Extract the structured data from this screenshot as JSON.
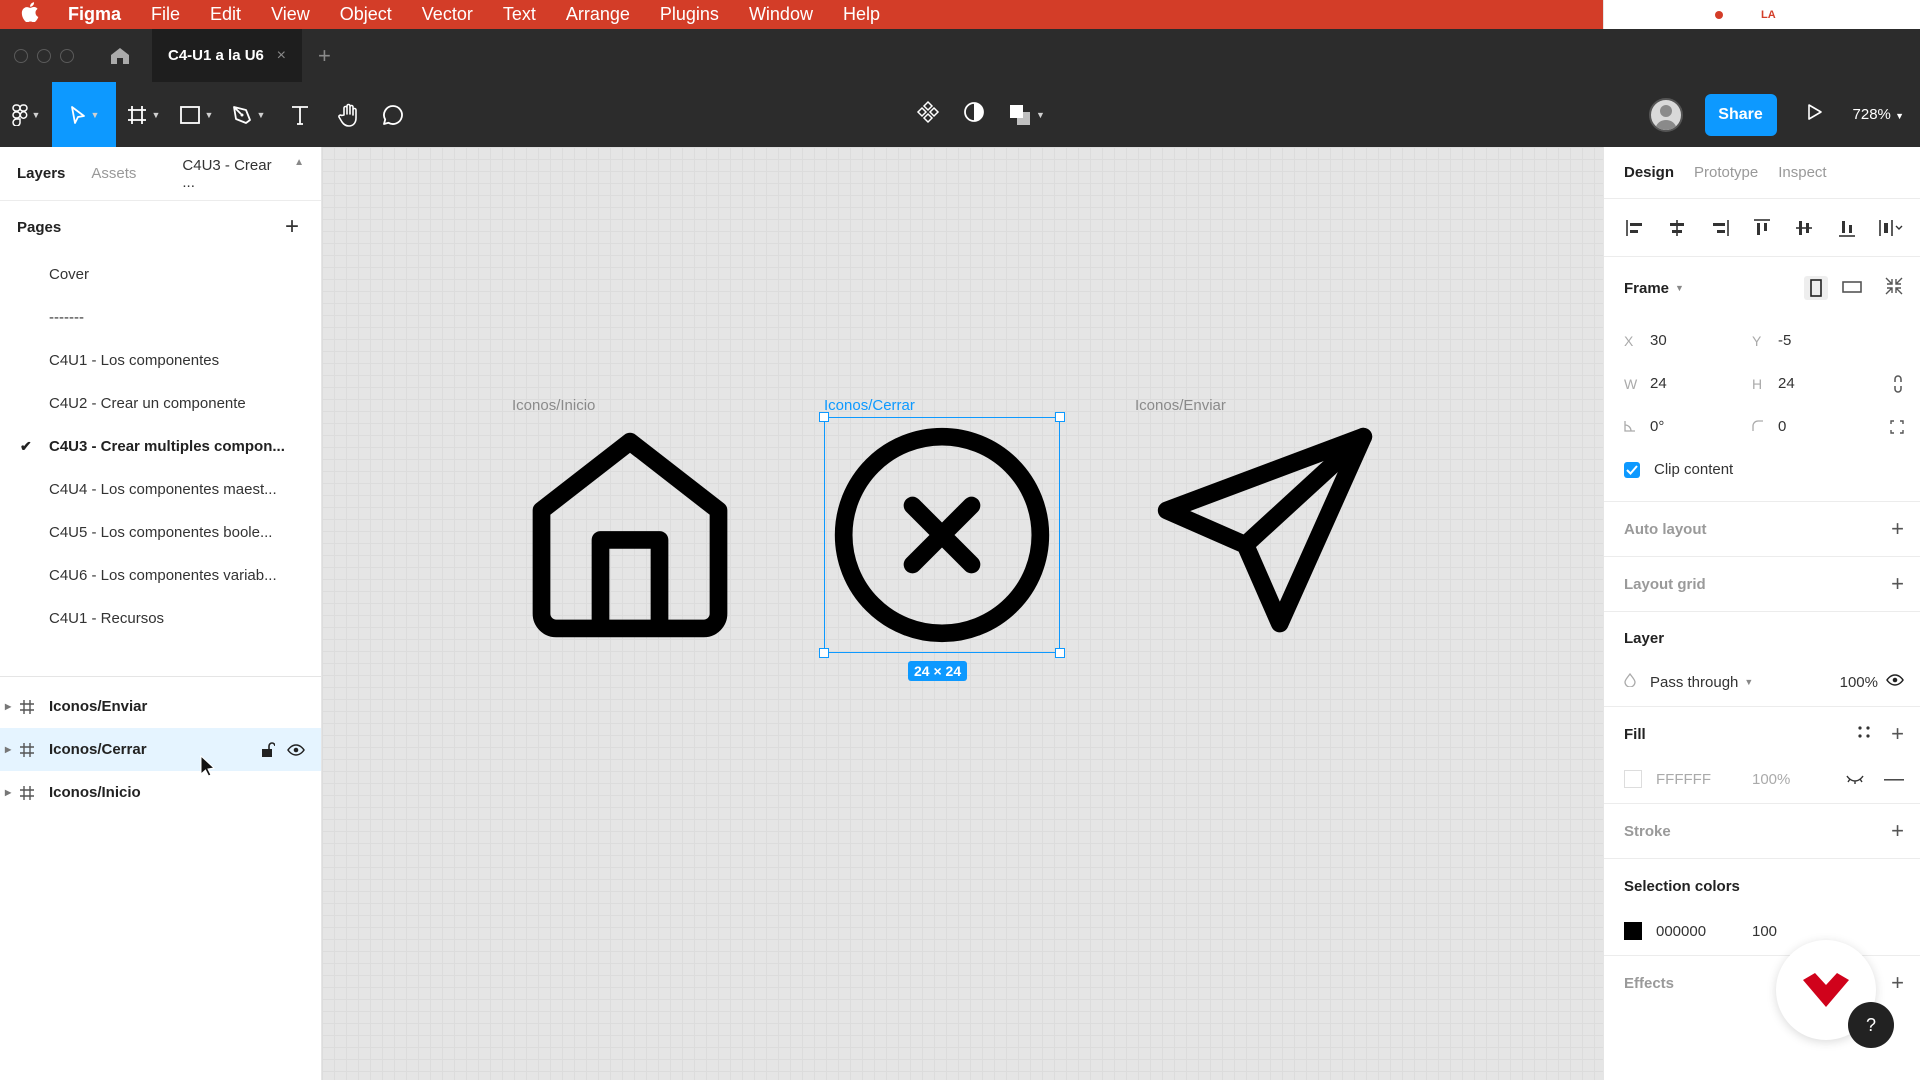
{
  "menubar": {
    "app": "Figma",
    "items": [
      "File",
      "Edit",
      "View",
      "Object",
      "Vector",
      "Text",
      "Arrange",
      "Plugins",
      "Window",
      "Help"
    ],
    "status_icons": [
      "creative-cloud-icon",
      "cloud-icon",
      "sync-icon",
      "language-icon",
      "bluetooth-icon",
      "wifi-icon",
      "search-icon",
      "control-center-icon",
      "clock-icon"
    ],
    "lang": "LA"
  },
  "tabbar": {
    "tab_title": "C4-U1 a la U6",
    "close": "×",
    "add": "+"
  },
  "toolbar": {
    "share_label": "Share",
    "zoom": "728%"
  },
  "left_panel": {
    "tabs": [
      "Layers",
      "Assets"
    ],
    "current_page": "C4U3 - Crear ...",
    "pages_title": "Pages",
    "pages": [
      {
        "label": "Cover",
        "selected": false
      },
      {
        "label": "-------",
        "selected": false
      },
      {
        "label": "C4U1 - Los componentes",
        "selected": false
      },
      {
        "label": "C4U2 - Crear un componente",
        "selected": false
      },
      {
        "label": "C4U3 - Crear multiples compon...",
        "selected": true
      },
      {
        "label": "C4U4 - Los componentes maest...",
        "selected": false
      },
      {
        "label": "C4U5 - Los componentes boole...",
        "selected": false
      },
      {
        "label": "C4U6 - Los componentes variab...",
        "selected": false
      },
      {
        "label": "C4U1 - Recursos",
        "selected": false
      }
    ],
    "layers": [
      {
        "label": "Iconos/Enviar",
        "highlighted": false
      },
      {
        "label": "Iconos/Cerrar",
        "highlighted": true
      },
      {
        "label": "Iconos/Inicio",
        "highlighted": false
      }
    ]
  },
  "canvas": {
    "frames": [
      {
        "label": "Iconos/Inicio",
        "icon": "home-icon"
      },
      {
        "label": "Iconos/Cerrar",
        "icon": "close-circle-icon"
      },
      {
        "label": "Iconos/Enviar",
        "icon": "send-icon"
      }
    ],
    "size_badge": "24 × 24"
  },
  "right_panel": {
    "tabs": [
      "Design",
      "Prototype",
      "Inspect"
    ],
    "frame": {
      "title": "Frame",
      "x_label": "X",
      "x": "30",
      "y_label": "Y",
      "y": "-5",
      "w_label": "W",
      "w": "24",
      "h_label": "H",
      "h": "24",
      "rotation": "0°",
      "radius": "0",
      "clip_content": "Clip content"
    },
    "auto_layout": "Auto layout",
    "layout_grid": "Layout grid",
    "layer": {
      "title": "Layer",
      "blend": "Pass through",
      "opacity": "100%"
    },
    "fill": {
      "title": "Fill",
      "hex": "FFFFFF",
      "opacity": "100%"
    },
    "stroke": "Stroke",
    "selection_colors": {
      "title": "Selection colors",
      "hex": "000000",
      "opacity": "100"
    },
    "effects": "Effects"
  },
  "colors": {
    "menubar": "#d33d28",
    "accent": "#0d99ff",
    "toolbar": "#2c2c2c"
  }
}
